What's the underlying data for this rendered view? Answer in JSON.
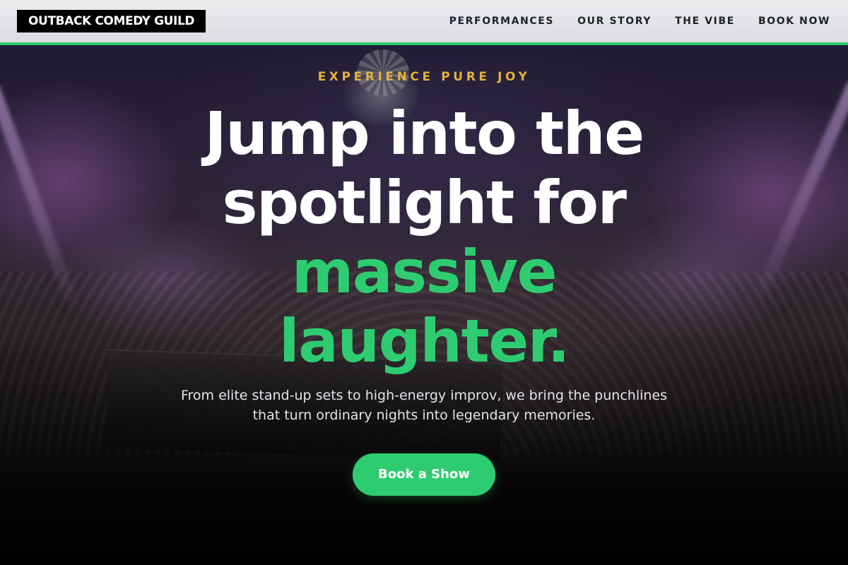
{
  "header": {
    "logo": "OUTBACK COMEDY GUILD",
    "nav": [
      {
        "label": "PERFORMANCES"
      },
      {
        "label": "OUR STORY"
      },
      {
        "label": "THE VIBE"
      },
      {
        "label": "BOOK NOW"
      }
    ]
  },
  "hero": {
    "eyebrow": "EXPERIENCE PURE JOY",
    "headline": {
      "line1": "Jump into the",
      "line2": "spotlight for",
      "line3": "massive",
      "line4": "laughter."
    },
    "subtext": "From elite stand-up sets to high-energy improv, we bring the punchlines that turn ordinary nights into legendary memories.",
    "cta_label": "Book a Show"
  },
  "colors": {
    "accent_green": "#2ecc71",
    "eyebrow_gold": "#e3b23c",
    "header_bg": "#e4e4e8",
    "logo_bg": "#000000"
  }
}
